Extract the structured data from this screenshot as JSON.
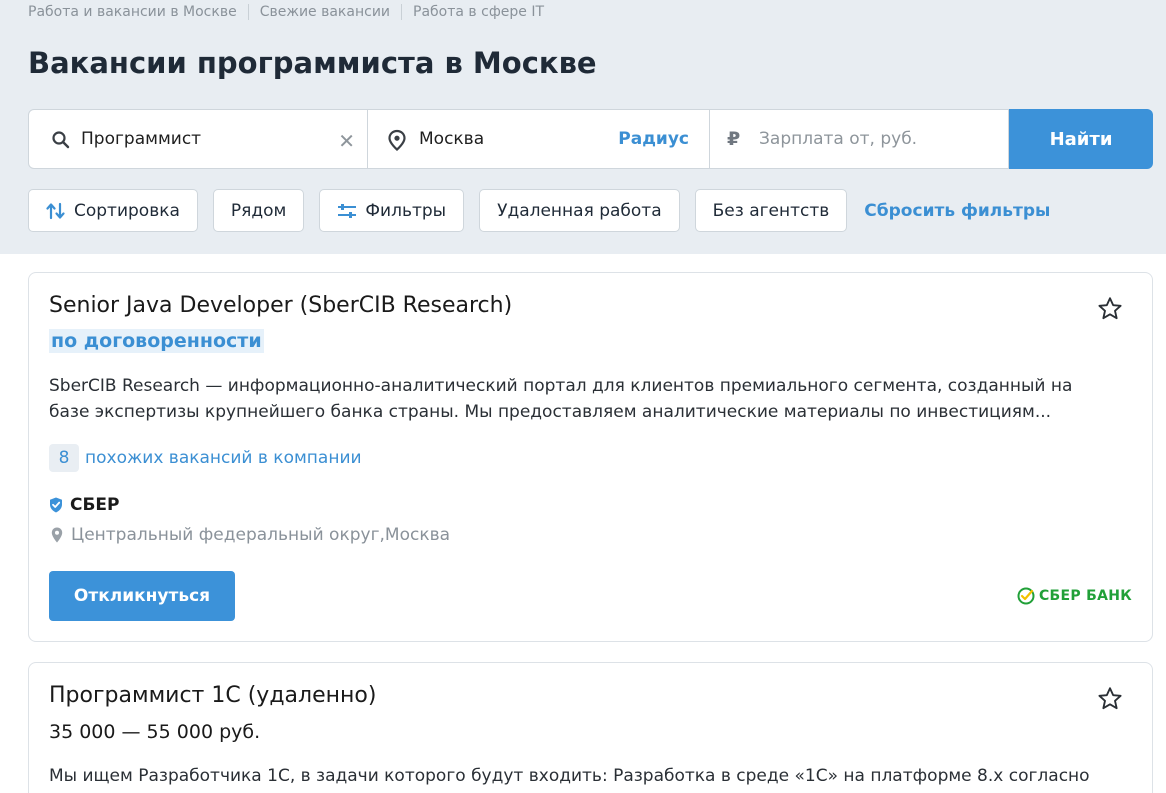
{
  "breadcrumbs": [
    "Работа и вакансии в Москве",
    "Свежие вакансии",
    "Работа в сфере IT"
  ],
  "page_title": "Вакансии программиста в Москве",
  "search": {
    "query_value": "Программист",
    "location_value": "Москва",
    "radius_label": "Радиус",
    "currency_symbol": "₽",
    "salary_placeholder": "Зарплата от, руб.",
    "find_label": "Найти"
  },
  "filters": {
    "sort_label": "Сортировка",
    "nearby_label": "Рядом",
    "filters_label": "Фильтры",
    "remote_label": "Удаленная работа",
    "no_agencies_label": "Без агентств",
    "reset_label": "Сбросить фильтры"
  },
  "vacancies": [
    {
      "title": "Senior Java Developer (SberCIB Research)",
      "salary": "по договоренности",
      "description": "SberCIB Research — информационно-аналитический портал для клиентов премиального сегмента, созданный на базе экспертизы крупнейшего банка страны. Мы предоставляем аналитические материалы по инвестициям...",
      "similar_count": "8",
      "similar_label": "похожих вакансий в компании",
      "company": "СБЕР",
      "location": "Центральный федеральный округ,Москва",
      "apply_label": "Откликнуться",
      "logo_text": "СБЕР БАНК"
    },
    {
      "title": "Программист 1С (удаленно)",
      "salary": "35 000 — 55 000 руб.",
      "description": "Мы ищем Разработчика 1С, в задачи которого будут входить: Разработка в среде «1С» на платформе 8.x согласно"
    }
  ],
  "colors": {
    "accent": "#3c92d9",
    "link": "#3b8fd3",
    "header_bg": "#e8edf2",
    "sber_green": "#21a038"
  }
}
